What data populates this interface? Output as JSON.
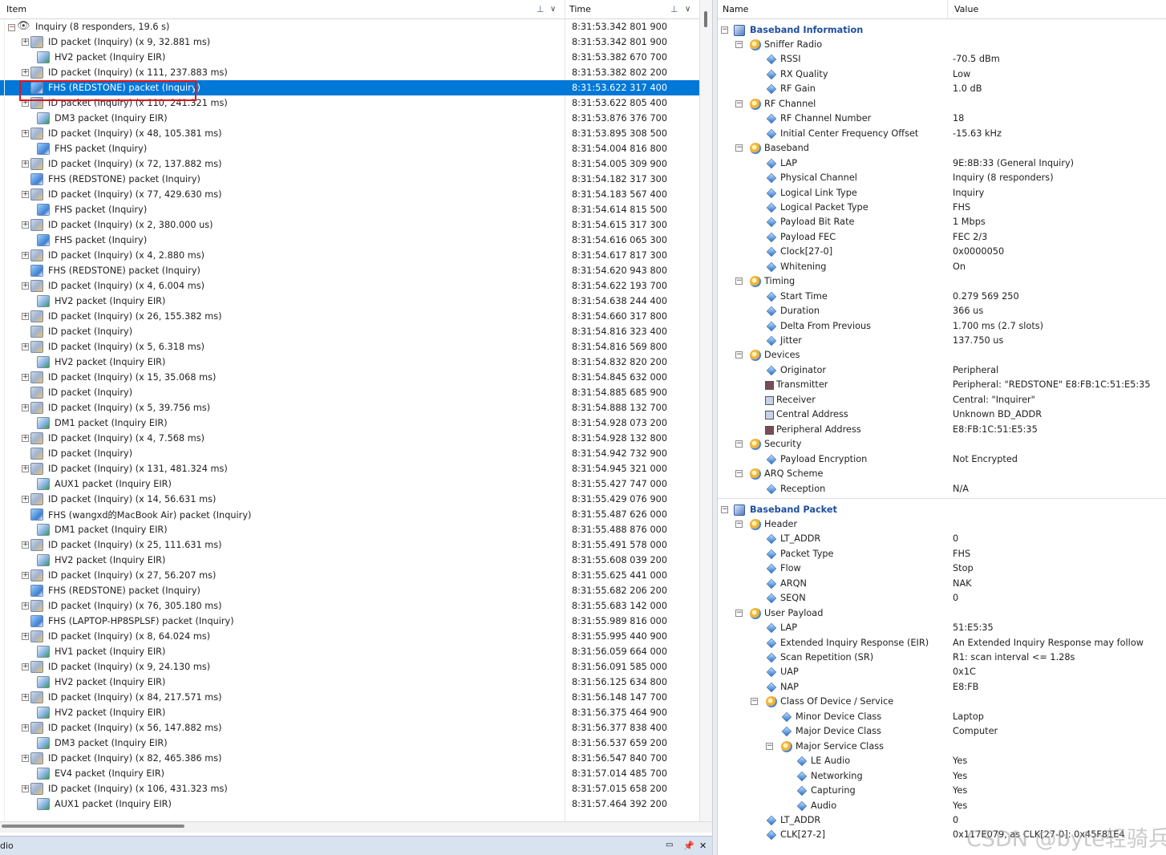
{
  "left_header": {
    "item_col": "Item",
    "time_col": "Time"
  },
  "root_row": {
    "label": "Inquiry (8 responders, 19.6 s)",
    "time": "8:31:53.342 801 900"
  },
  "rows": [
    {
      "label": "ID packet (Inquiry) (x 9, 32.881 ms)",
      "time": "8:31:53.342 801 900",
      "kind": "id",
      "exp": true,
      "indent": 1
    },
    {
      "label": "HV2 packet (Inquiry EIR)",
      "time": "8:31:53.382 670 700",
      "kind": "eir",
      "exp": false,
      "indent": 2
    },
    {
      "label": "ID packet (Inquiry) (x 111, 237.883 ms)",
      "time": "8:31:53.382 802 200",
      "kind": "id",
      "exp": true,
      "indent": 1
    },
    {
      "label": "FHS (REDSTONE) packet (Inquiry)",
      "time": "8:31:53.622 317 400",
      "kind": "fhs",
      "exp": false,
      "indent": 1,
      "selected": true
    },
    {
      "label": "ID packet (Inquiry) (x 110, 241.321 ms)",
      "time": "8:31:53.622 805 400",
      "kind": "id",
      "exp": true,
      "indent": 1
    },
    {
      "label": "DM3 packet (Inquiry EIR)",
      "time": "8:31:53.876 376 700",
      "kind": "eir",
      "exp": false,
      "indent": 2
    },
    {
      "label": "ID packet (Inquiry) (x 48, 105.381 ms)",
      "time": "8:31:53.895 308 500",
      "kind": "id",
      "exp": true,
      "indent": 1
    },
    {
      "label": "FHS packet (Inquiry)",
      "time": "8:31:54.004 816 800",
      "kind": "fhs",
      "exp": false,
      "indent": 2
    },
    {
      "label": "ID packet (Inquiry) (x 72, 137.882 ms)",
      "time": "8:31:54.005 309 900",
      "kind": "id",
      "exp": true,
      "indent": 1
    },
    {
      "label": "FHS (REDSTONE) packet (Inquiry)",
      "time": "8:31:54.182 317 300",
      "kind": "fhs",
      "exp": false,
      "indent": 1
    },
    {
      "label": "ID packet (Inquiry) (x 77, 429.630 ms)",
      "time": "8:31:54.183 567 400",
      "kind": "id",
      "exp": true,
      "indent": 1
    },
    {
      "label": "FHS packet (Inquiry)",
      "time": "8:31:54.614 815 500",
      "kind": "fhs",
      "exp": false,
      "indent": 2
    },
    {
      "label": "ID packet (Inquiry) (x 2, 380.000 us)",
      "time": "8:31:54.615 317 300",
      "kind": "id",
      "exp": true,
      "indent": 1
    },
    {
      "label": "FHS packet (Inquiry)",
      "time": "8:31:54.616 065 300",
      "kind": "fhs",
      "exp": false,
      "indent": 2
    },
    {
      "label": "ID packet (Inquiry) (x 4, 2.880 ms)",
      "time": "8:31:54.617 817 300",
      "kind": "id",
      "exp": true,
      "indent": 1
    },
    {
      "label": "FHS (REDSTONE) packet (Inquiry)",
      "time": "8:31:54.620 943 800",
      "kind": "fhs",
      "exp": false,
      "indent": 1
    },
    {
      "label": "ID packet (Inquiry) (x 4, 6.004 ms)",
      "time": "8:31:54.622 193 700",
      "kind": "id",
      "exp": true,
      "indent": 1
    },
    {
      "label": "HV2 packet (Inquiry EIR)",
      "time": "8:31:54.638 244 400",
      "kind": "eir",
      "exp": false,
      "indent": 2
    },
    {
      "label": "ID packet (Inquiry) (x 26, 155.382 ms)",
      "time": "8:31:54.660 317 800",
      "kind": "id",
      "exp": true,
      "indent": 1
    },
    {
      "label": "ID packet (Inquiry)",
      "time": "8:31:54.816 323 400",
      "kind": "id",
      "exp": false,
      "indent": 1
    },
    {
      "label": "ID packet (Inquiry) (x 5, 6.318 ms)",
      "time": "8:31:54.816 569 800",
      "kind": "id",
      "exp": true,
      "indent": 1
    },
    {
      "label": "HV2 packet (Inquiry EIR)",
      "time": "8:31:54.832 820 200",
      "kind": "eir",
      "exp": false,
      "indent": 2
    },
    {
      "label": "ID packet (Inquiry) (x 15, 35.068 ms)",
      "time": "8:31:54.845 632 000",
      "kind": "id",
      "exp": true,
      "indent": 1
    },
    {
      "label": "ID packet (Inquiry)",
      "time": "8:31:54.885 685 900",
      "kind": "id",
      "exp": false,
      "indent": 1
    },
    {
      "label": "ID packet (Inquiry) (x 5, 39.756 ms)",
      "time": "8:31:54.888 132 700",
      "kind": "id",
      "exp": true,
      "indent": 1
    },
    {
      "label": "DM1 packet (Inquiry EIR)",
      "time": "8:31:54.928 073 200",
      "kind": "eir",
      "exp": false,
      "indent": 2
    },
    {
      "label": "ID packet (Inquiry) (x 4, 7.568 ms)",
      "time": "8:31:54.928 132 800",
      "kind": "id",
      "exp": true,
      "indent": 1
    },
    {
      "label": "ID packet (Inquiry)",
      "time": "8:31:54.942 732 900",
      "kind": "id",
      "exp": false,
      "indent": 1
    },
    {
      "label": "ID packet (Inquiry) (x 131, 481.324 ms)",
      "time": "8:31:54.945 321 000",
      "kind": "id",
      "exp": true,
      "indent": 1
    },
    {
      "label": "AUX1 packet (Inquiry EIR)",
      "time": "8:31:55.427 747 000",
      "kind": "eir",
      "exp": false,
      "indent": 2
    },
    {
      "label": "ID packet (Inquiry) (x 14, 56.631 ms)",
      "time": "8:31:55.429 076 900",
      "kind": "id",
      "exp": true,
      "indent": 1
    },
    {
      "label": "FHS (wangxd的MacBook Air) packet (Inquiry)",
      "time": "8:31:55.487 626 000",
      "kind": "fhs",
      "exp": false,
      "indent": 1
    },
    {
      "label": "DM1 packet (Inquiry EIR)",
      "time": "8:31:55.488 876 000",
      "kind": "eir",
      "exp": false,
      "indent": 2
    },
    {
      "label": "ID packet (Inquiry) (x 25, 111.631 ms)",
      "time": "8:31:55.491 578 000",
      "kind": "id",
      "exp": true,
      "indent": 1
    },
    {
      "label": "HV2 packet (Inquiry EIR)",
      "time": "8:31:55.608 039 200",
      "kind": "eir",
      "exp": false,
      "indent": 2
    },
    {
      "label": "ID packet (Inquiry) (x 27, 56.207 ms)",
      "time": "8:31:55.625 441 000",
      "kind": "id",
      "exp": true,
      "indent": 1
    },
    {
      "label": "FHS (REDSTONE) packet (Inquiry)",
      "time": "8:31:55.682 206 200",
      "kind": "fhs",
      "exp": false,
      "indent": 1
    },
    {
      "label": "ID packet (Inquiry) (x 76, 305.180 ms)",
      "time": "8:31:55.683 142 000",
      "kind": "id",
      "exp": true,
      "indent": 1
    },
    {
      "label": "FHS (LAPTOP-HP8SPLSF) packet (Inquiry)",
      "time": "8:31:55.989 816 000",
      "kind": "fhs",
      "exp": false,
      "indent": 1
    },
    {
      "label": "ID packet (Inquiry) (x 8, 64.024 ms)",
      "time": "8:31:55.995 440 900",
      "kind": "id",
      "exp": true,
      "indent": 1
    },
    {
      "label": "HV1 packet (Inquiry EIR)",
      "time": "8:31:56.059 664 000",
      "kind": "eir",
      "exp": false,
      "indent": 2
    },
    {
      "label": "ID packet (Inquiry) (x 9, 24.130 ms)",
      "time": "8:31:56.091 585 000",
      "kind": "id",
      "exp": true,
      "indent": 1
    },
    {
      "label": "HV2 packet (Inquiry EIR)",
      "time": "8:31:56.125 634 800",
      "kind": "eir",
      "exp": false,
      "indent": 2
    },
    {
      "label": "ID packet (Inquiry) (x 84, 217.571 ms)",
      "time": "8:31:56.148 147 700",
      "kind": "id",
      "exp": true,
      "indent": 1
    },
    {
      "label": "HV2 packet (Inquiry EIR)",
      "time": "8:31:56.375 464 900",
      "kind": "eir",
      "exp": false,
      "indent": 2
    },
    {
      "label": "ID packet (Inquiry) (x 56, 147.882 ms)",
      "time": "8:31:56.377 838 400",
      "kind": "id",
      "exp": true,
      "indent": 1
    },
    {
      "label": "DM3 packet (Inquiry EIR)",
      "time": "8:31:56.537 659 200",
      "kind": "eir",
      "exp": false,
      "indent": 2
    },
    {
      "label": "ID packet (Inquiry) (x 82, 465.386 ms)",
      "time": "8:31:56.547 840 700",
      "kind": "id",
      "exp": true,
      "indent": 1
    },
    {
      "label": "EV4 packet (Inquiry EIR)",
      "time": "8:31:57.014 485 700",
      "kind": "eir",
      "exp": false,
      "indent": 2
    },
    {
      "label": "ID packet (Inquiry) (x 106, 431.323 ms)",
      "time": "8:31:57.015 658 200",
      "kind": "id",
      "exp": true,
      "indent": 1
    },
    {
      "label": "AUX1 packet (Inquiry EIR)",
      "time": "8:31:57.464 392 200",
      "kind": "eir",
      "exp": false,
      "indent": 2
    }
  ],
  "bottom_bar": {
    "label": "dio",
    "pin": "📌",
    "close": "✕"
  },
  "right_header": {
    "name_col": "Name",
    "value_col": "Value"
  },
  "details": [
    {
      "name": "Baseband Information",
      "value": "",
      "level": 0,
      "type": "section",
      "exp": "−"
    },
    {
      "name": "Sniffer Radio",
      "value": "",
      "level": 1,
      "type": "gear",
      "exp": "−"
    },
    {
      "name": "RSSI",
      "value": "-70.5 dBm",
      "level": 2,
      "type": "diamond"
    },
    {
      "name": "RX Quality",
      "value": "Low",
      "level": 2,
      "type": "diamond"
    },
    {
      "name": "RF Gain",
      "value": "1.0 dB",
      "level": 2,
      "type": "diamond"
    },
    {
      "name": "RF Channel",
      "value": "",
      "level": 1,
      "type": "gear",
      "exp": "−"
    },
    {
      "name": "RF Channel Number",
      "value": "18",
      "level": 2,
      "type": "diamond"
    },
    {
      "name": "Initial Center Frequency Offset",
      "value": "-15.63 kHz",
      "level": 2,
      "type": "diamond"
    },
    {
      "name": "Baseband",
      "value": "",
      "level": 1,
      "type": "gear",
      "exp": "−"
    },
    {
      "name": "LAP",
      "value": "9E:8B:33 (General Inquiry)",
      "level": 2,
      "type": "diamond"
    },
    {
      "name": "Physical Channel",
      "value": "Inquiry (8 responders)",
      "level": 2,
      "type": "diamond"
    },
    {
      "name": "Logical Link Type",
      "value": "Inquiry",
      "level": 2,
      "type": "diamond"
    },
    {
      "name": "Logical Packet Type",
      "value": "FHS",
      "level": 2,
      "type": "diamond"
    },
    {
      "name": "Payload Bit Rate",
      "value": "1 Mbps",
      "level": 2,
      "type": "diamond"
    },
    {
      "name": "Payload FEC",
      "value": "FEC 2/3",
      "level": 2,
      "type": "diamond"
    },
    {
      "name": "Clock[27-0]",
      "value": "0x0000050",
      "level": 2,
      "type": "diamond"
    },
    {
      "name": "Whitening",
      "value": "On",
      "level": 2,
      "type": "diamond"
    },
    {
      "name": "Timing",
      "value": "",
      "level": 1,
      "type": "gear",
      "exp": "−"
    },
    {
      "name": "Start Time",
      "value": "0.279 569 250",
      "level": 2,
      "type": "diamond"
    },
    {
      "name": "Duration",
      "value": "366 us",
      "level": 2,
      "type": "diamond"
    },
    {
      "name": "Delta From Previous",
      "value": "1.700 ms (2.7 slots)",
      "level": 2,
      "type": "diamond"
    },
    {
      "name": "Jitter",
      "value": "137.750 us",
      "level": 2,
      "type": "diamond"
    },
    {
      "name": "Devices",
      "value": "",
      "level": 1,
      "type": "gear",
      "exp": "−"
    },
    {
      "name": "Originator",
      "value": "Peripheral",
      "level": 2,
      "type": "diamond"
    },
    {
      "name": "Transmitter",
      "value": "Peripheral: \"REDSTONE\" E8:FB:1C:51:E5:35",
      "level": 2,
      "type": "sq",
      "color": "#7a4b55"
    },
    {
      "name": "Receiver",
      "value": "Central: \"Inquirer\"",
      "level": 2,
      "type": "sq",
      "color": "#c6d3e6"
    },
    {
      "name": "Central Address",
      "value": "Unknown BD_ADDR",
      "level": 2,
      "type": "sq",
      "color": "#c6d3e6"
    },
    {
      "name": "Peripheral Address",
      "value": "E8:FB:1C:51:E5:35",
      "level": 2,
      "type": "sq",
      "color": "#7a4b55"
    },
    {
      "name": "Security",
      "value": "",
      "level": 1,
      "type": "gear",
      "exp": "−"
    },
    {
      "name": "Payload Encryption",
      "value": "Not Encrypted",
      "level": 2,
      "type": "diamond"
    },
    {
      "name": "ARQ Scheme",
      "value": "",
      "level": 1,
      "type": "gear",
      "exp": "−"
    },
    {
      "name": "Reception",
      "value": "N/A",
      "level": 2,
      "type": "diamond"
    },
    {
      "name": "Baseband Packet",
      "value": "",
      "level": 0,
      "type": "section",
      "exp": "−"
    },
    {
      "name": "Header",
      "value": "",
      "level": 1,
      "type": "gear",
      "exp": "−"
    },
    {
      "name": "LT_ADDR",
      "value": "0",
      "level": 2,
      "type": "diamond"
    },
    {
      "name": "Packet Type",
      "value": "FHS",
      "level": 2,
      "type": "diamond"
    },
    {
      "name": "Flow",
      "value": "Stop",
      "level": 2,
      "type": "diamond"
    },
    {
      "name": "ARQN",
      "value": "NAK",
      "level": 2,
      "type": "diamond"
    },
    {
      "name": "SEQN",
      "value": "0",
      "level": 2,
      "type": "diamond"
    },
    {
      "name": "User Payload",
      "value": "",
      "level": 1,
      "type": "gear",
      "exp": "−"
    },
    {
      "name": "LAP",
      "value": "51:E5:35",
      "level": 2,
      "type": "diamond"
    },
    {
      "name": "Extended Inquiry Response (EIR)",
      "value": "An Extended Inquiry Response may follow",
      "level": 2,
      "type": "diamond"
    },
    {
      "name": "Scan Repetition (SR)",
      "value": "R1: scan interval <= 1.28s",
      "level": 2,
      "type": "diamond"
    },
    {
      "name": "UAP",
      "value": "0x1C",
      "level": 2,
      "type": "diamond"
    },
    {
      "name": "NAP",
      "value": "E8:FB",
      "level": 2,
      "type": "diamond"
    },
    {
      "name": "Class Of Device / Service",
      "value": "",
      "level": 2,
      "type": "gear",
      "exp": "−"
    },
    {
      "name": "Minor Device Class",
      "value": "Laptop",
      "level": 3,
      "type": "diamond"
    },
    {
      "name": "Major Device Class",
      "value": "Computer",
      "level": 3,
      "type": "diamond"
    },
    {
      "name": "Major Service Class",
      "value": "",
      "level": 3,
      "type": "gear",
      "exp": "−"
    },
    {
      "name": "LE Audio",
      "value": "Yes",
      "level": 4,
      "type": "diamond"
    },
    {
      "name": "Networking",
      "value": "Yes",
      "level": 4,
      "type": "diamond"
    },
    {
      "name": "Capturing",
      "value": "Yes",
      "level": 4,
      "type": "diamond"
    },
    {
      "name": "Audio",
      "value": "Yes",
      "level": 4,
      "type": "diamond"
    },
    {
      "name": "LT_ADDR",
      "value": "0",
      "level": 2,
      "type": "diamond"
    },
    {
      "name": "CLK[27-2]",
      "value": "0x117E079, as CLK[27-0]: 0x45F81E4",
      "level": 2,
      "type": "diamond"
    }
  ],
  "watermark": "CSDN @byte轻骑兵",
  "colors": {
    "selection": "#0078d7",
    "section_title": "#1f4f9e",
    "highlight_box": "#e0141c"
  }
}
